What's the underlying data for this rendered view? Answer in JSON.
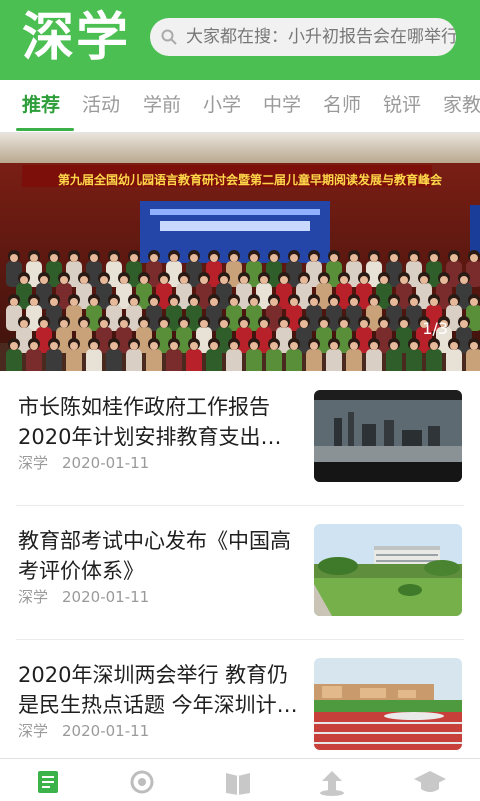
{
  "header": {
    "logo": "深学",
    "search_placeholder": "大家都在搜：小升初报告会在哪举行"
  },
  "tabs": [
    {
      "label": "推荐",
      "active": true
    },
    {
      "label": "活动",
      "active": false
    },
    {
      "label": "学前",
      "active": false
    },
    {
      "label": "小学",
      "active": false
    },
    {
      "label": "中学",
      "active": false
    },
    {
      "label": "名师",
      "active": false
    },
    {
      "label": "锐评",
      "active": false
    },
    {
      "label": "家教",
      "active": false
    }
  ],
  "banner": {
    "title": "第九届全国幼儿园语言教育研讨会暨第二届儿童早期阅读发展与教育峰会",
    "indicator": "1/3"
  },
  "news": [
    {
      "title": "市长陈如桂作政府工作报告 2020年计划安排教育支出…",
      "source": "深学",
      "date": "2020-01-11"
    },
    {
      "title": "教育部考试中心发布《中国高考评价体系》",
      "source": "深学",
      "date": "2020-01-11"
    },
    {
      "title": "2020年深圳两会举行 教育仍是民生热点话题 今年深圳计…",
      "source": "深学",
      "date": "2020-01-11"
    }
  ],
  "bottom_nav": [
    "news-icon",
    "discover-icon",
    "book-icon",
    "teacher-icon",
    "graduation-cap-icon"
  ],
  "colors": {
    "brand": "#4bbf52",
    "active_tab": "#2e9e3a"
  }
}
